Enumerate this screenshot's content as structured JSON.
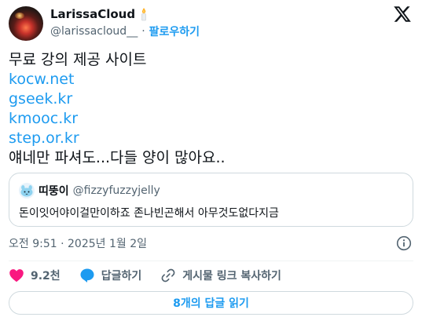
{
  "author": {
    "display_name": "LarissaCloud",
    "handle": "@larissacloud__",
    "separator": "·",
    "follow_label": "팔로우하기",
    "badge_icon": "candle-icon",
    "brand_icon": "x-logo-icon"
  },
  "tweet": {
    "lines": [
      {
        "text": "무료 강의 제공 사이트",
        "link": false
      },
      {
        "text": "kocw.net",
        "link": true
      },
      {
        "text": "gseek.kr",
        "link": true
      },
      {
        "text": "kmooc.kr",
        "link": true
      },
      {
        "text": "step.or.kr",
        "link": true
      },
      {
        "text": "얘네만 파셔도...다들 양이 많아요..",
        "link": false
      }
    ]
  },
  "quote": {
    "display_name": "띠뚱이",
    "handle": "@fizzyfuzzyjelly",
    "text": "돈이잇어야이걸만이하죠 존나빈곤해서 아무것도없다지금"
  },
  "timestamp": "오전 9:51 · 2025년 1월 2일",
  "actions": {
    "likes": "9.2천",
    "reply_label": "답글하기",
    "copy_link_label": "게시물 링크 복사하기"
  },
  "read_replies_label": "8개의 답글 읽기",
  "colors": {
    "link": "#1d9bf0",
    "like": "#f91880",
    "reply": "#1d9bf0",
    "muted": "#536471",
    "text": "#0f1419"
  }
}
